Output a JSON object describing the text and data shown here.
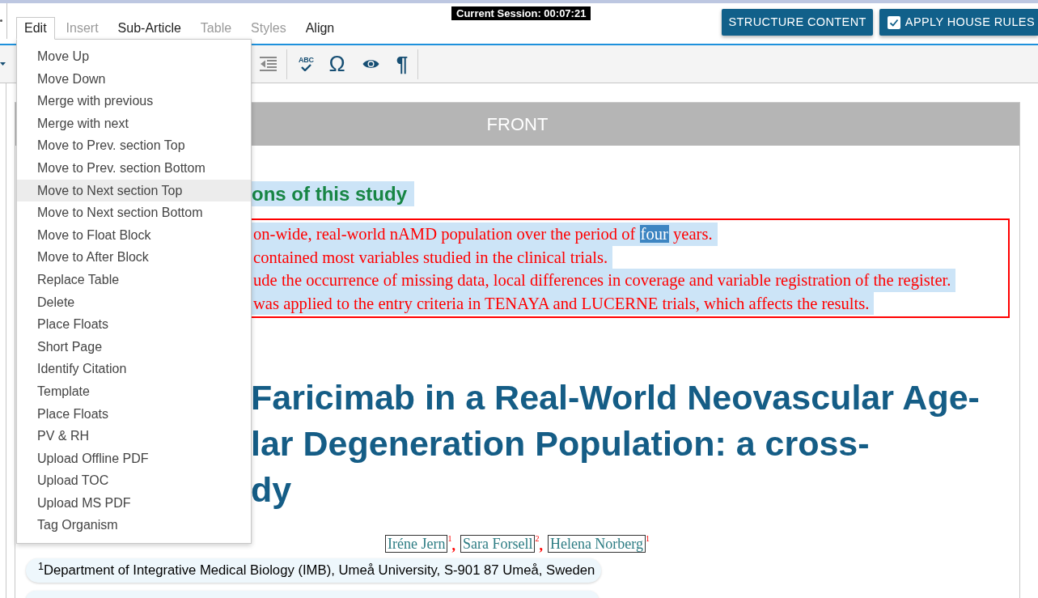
{
  "session": {
    "label": "Current Session: 00:07:21"
  },
  "menubar": [
    {
      "label": "Edit",
      "selected": true,
      "disabled": false
    },
    {
      "label": "Insert",
      "selected": false,
      "disabled": true
    },
    {
      "label": "Sub-Article",
      "selected": false,
      "disabled": false
    },
    {
      "label": "Table",
      "selected": false,
      "disabled": true
    },
    {
      "label": "Styles",
      "selected": false,
      "disabled": true
    },
    {
      "label": "Align",
      "selected": false,
      "disabled": false
    }
  ],
  "actions": [
    {
      "kind": "button",
      "label": "STRUCTURE CONTENT"
    },
    {
      "kind": "checkbox",
      "label": "APPLY HOUSE RULES",
      "checked": true
    }
  ],
  "toolbar": {
    "left": [
      {
        "kind": "caret"
      }
    ],
    "right": [
      {
        "kind": "outdent"
      },
      {
        "kind": "separator"
      },
      {
        "kind": "spellcheck",
        "label": "ABC"
      },
      {
        "kind": "omega",
        "label": "Ω"
      },
      {
        "kind": "eye"
      },
      {
        "kind": "pilcrow",
        "label": "¶"
      },
      {
        "kind": "separator"
      }
    ]
  },
  "edit_menu": {
    "items": [
      {
        "label": "Move Up",
        "selected": false
      },
      {
        "label": "Move Down",
        "selected": false
      },
      {
        "label": "Merge with previous",
        "selected": false
      },
      {
        "label": "Merge with next",
        "selected": false
      },
      {
        "label": "Move to Prev. section Top",
        "selected": false
      },
      {
        "label": "Move to Prev. section Bottom",
        "selected": false
      },
      {
        "label": "Move to Next section Top",
        "selected": true
      },
      {
        "label": "Move to Next section Bottom",
        "selected": false
      },
      {
        "label": "Move to Float Block",
        "selected": false
      },
      {
        "label": "Move to After Block",
        "selected": false
      },
      {
        "label": "Replace Table",
        "selected": false
      },
      {
        "label": "Delete",
        "selected": false
      },
      {
        "label": "Place Floats",
        "selected": false
      },
      {
        "label": "Short Page",
        "selected": false
      },
      {
        "label": "Identify Citation",
        "selected": false
      },
      {
        "label": "Template",
        "selected": false
      },
      {
        "label": "Place Floats",
        "selected": false
      },
      {
        "label": "PV & RH",
        "selected": false
      },
      {
        "label": "Upload Offline PDF",
        "selected": false
      },
      {
        "label": "Upload TOC",
        "selected": false
      },
      {
        "label": "Upload MS PDF",
        "selected": false
      },
      {
        "label": "Tag Organism",
        "selected": false
      }
    ]
  },
  "section": {
    "title": "FRONT",
    "heading": "ons of this study",
    "key_points": [
      {
        "segments": [
          {
            "text": "on-wide, real-world nAMD population over the period of ",
            "selected": false
          },
          {
            "text": "four",
            "selected": true
          },
          {
            "text": " years.",
            "selected": false
          }
        ]
      },
      {
        "segments": [
          {
            "text": "contained most variables studied in the clinical trials.",
            "selected": false
          }
        ]
      },
      {
        "segments": [
          {
            "text": "ude the occurrence of missing data, local differences in coverage and variable registration of the register.",
            "selected": false
          }
        ]
      },
      {
        "segments": [
          {
            "text": "was applied to the entry criteria in TENAYA and LUCERNE trials, which affects the results.",
            "selected": false
          }
        ]
      }
    ],
    "title_lines": [
      "Faricimab in a Real-World Neovascular Age-",
      "lar Degeneration Population: a cross-",
      "dy"
    ],
    "authors": [
      {
        "name": "Iréne Jern",
        "affiliation": "1"
      },
      {
        "name": "Sara Forsell",
        "affiliation": "2"
      },
      {
        "name": "Helena Norberg",
        "affiliation": "1"
      }
    ],
    "author_separator": ",",
    "affiliations": [
      "$^{1}$Department of Integrative Medical Biology (IMB), Umeå University, S-901 87 Umeå, Sweden"
    ]
  }
}
